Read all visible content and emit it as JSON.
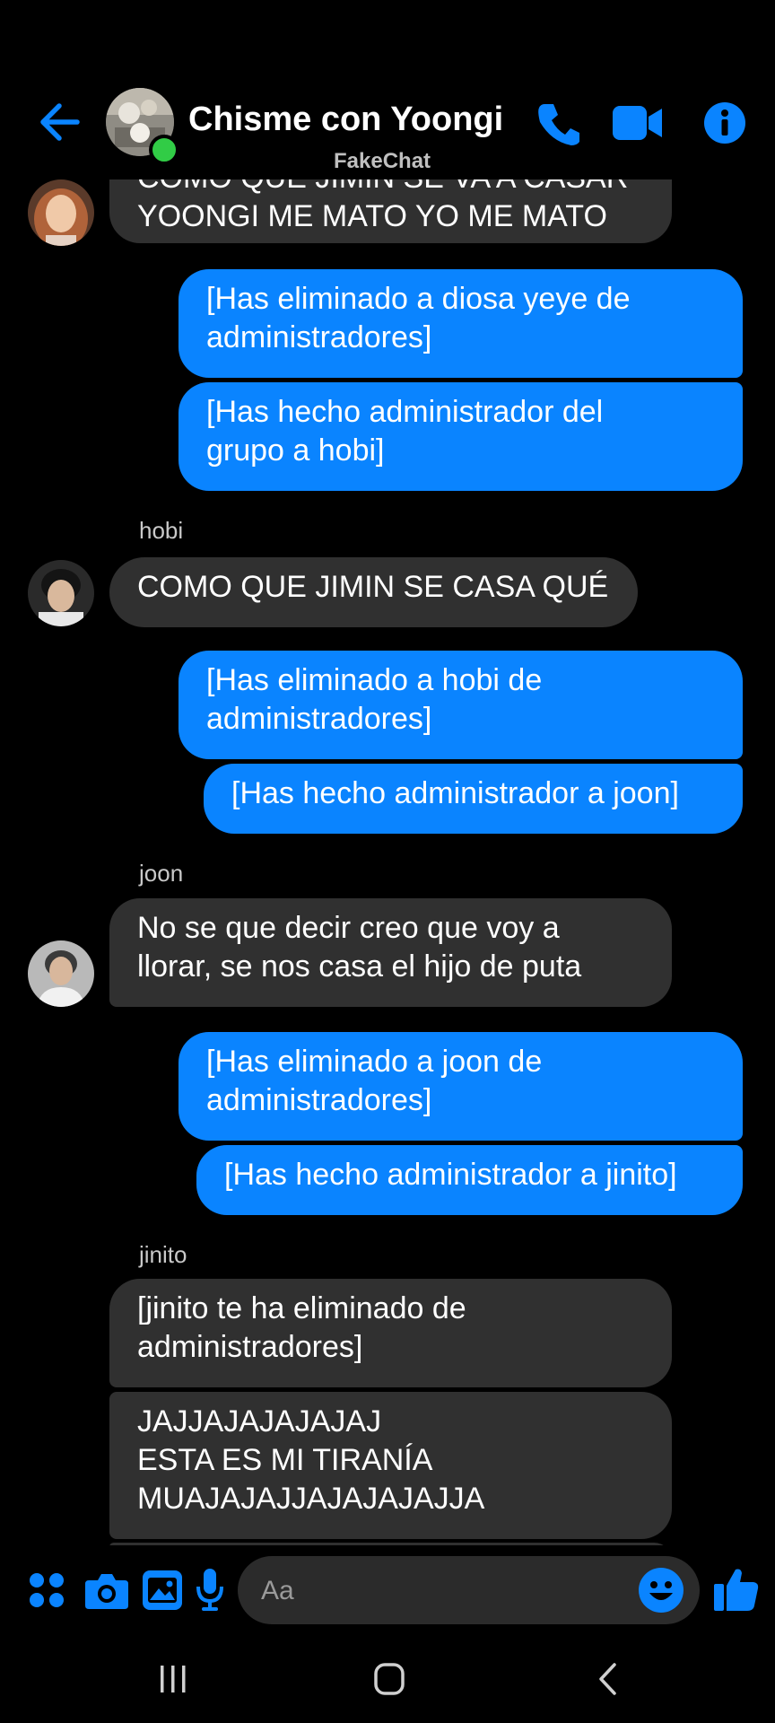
{
  "header": {
    "title": "Chisme con Yoongi",
    "subtitle": "FakeChat",
    "colors": {
      "accent": "#0a84ff",
      "online": "#31cc46"
    },
    "icons": [
      "back-arrow-icon",
      "phone-icon",
      "video-camera-icon",
      "info-icon"
    ]
  },
  "messages": [
    {
      "type": "in",
      "lines": [
        "COMO QUE JIMIN SE VA A CASAR",
        "YOONGI ME MATO YO ME MATO"
      ]
    },
    {
      "type": "out",
      "lines": [
        "[Has eliminado a diosa yeye de",
        "administradores]"
      ]
    },
    {
      "type": "out",
      "lines": [
        "[Has hecho administrador del",
        "grupo a hobi]"
      ]
    },
    {
      "type": "sender",
      "text": "hobi"
    },
    {
      "type": "in",
      "lines": [
        "COMO QUE JIMIN SE CASA QUÉ"
      ]
    },
    {
      "type": "out",
      "lines": [
        "[Has eliminado a hobi de",
        "administradores]"
      ]
    },
    {
      "type": "out",
      "lines": [
        "[Has hecho administrador a joon]"
      ]
    },
    {
      "type": "sender",
      "text": "joon"
    },
    {
      "type": "in",
      "lines": [
        "No se que decir creo que voy a",
        "llorar, se nos casa el hijo de puta"
      ]
    },
    {
      "type": "out",
      "lines": [
        "[Has eliminado a joon de",
        "administradores]"
      ]
    },
    {
      "type": "out",
      "lines": [
        "[Has hecho administrador a jinito]"
      ]
    },
    {
      "type": "sender",
      "text": "jinito"
    },
    {
      "type": "in",
      "lines": [
        "[jinito te ha eliminado de",
        "administradores]"
      ]
    },
    {
      "type": "in",
      "lines": [
        "JAJJAJAJAJAJAJ",
        "ESTA ES MI TIRANÍA",
        "MUAJAJAJJAJAJAJAJJA"
      ]
    }
  ],
  "composer": {
    "placeholder": "Aa",
    "icons": [
      "apps-grid-icon",
      "camera-icon",
      "gallery-icon",
      "microphone-icon",
      "emoji-icon",
      "thumbs-up-icon"
    ]
  },
  "navbar": {
    "icons": [
      "recents-icon",
      "home-icon",
      "back-icon"
    ]
  }
}
